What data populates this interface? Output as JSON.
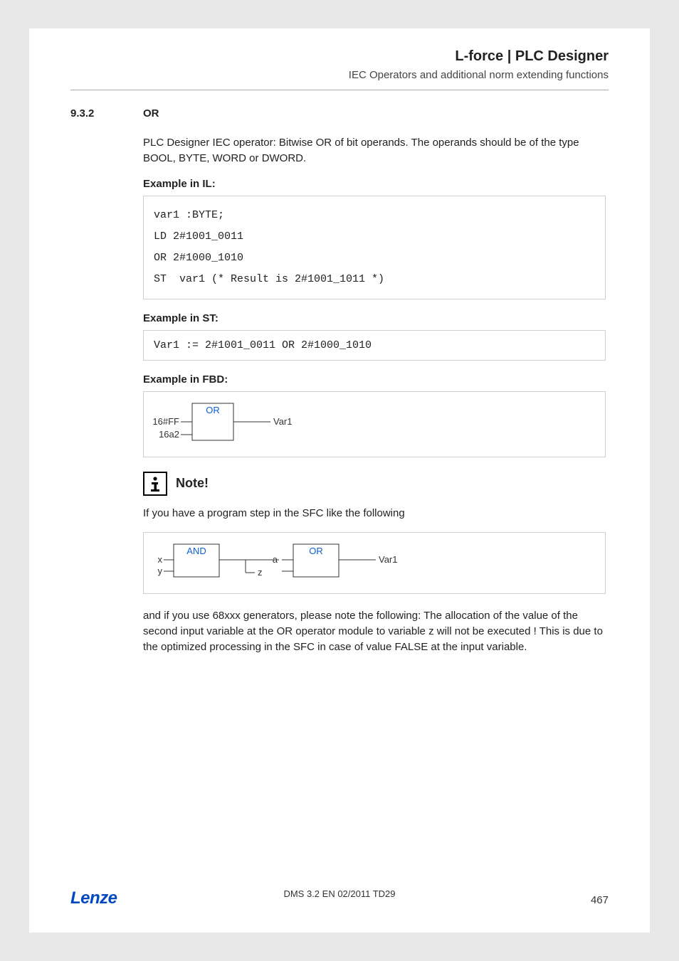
{
  "header": {
    "title": "L-force | PLC Designer",
    "subtitle": "IEC Operators and additional norm extending functions"
  },
  "section": {
    "number": "9.3.2",
    "title": "OR"
  },
  "intro": "PLC Designer IEC operator: Bitwise OR of bit operands. The operands should be of the type BOOL, BYTE, WORD or DWORD.",
  "labels": {
    "example_il": "Example in IL:",
    "example_st": "Example in ST:",
    "example_fbd": "Example in FBD:",
    "note": "Note!"
  },
  "code": {
    "il": "var1 :BYTE;\nLD 2#1001_0011\nOR 2#1000_1010\nST  var1 (* Result is 2#1001_1011 *)",
    "st": "Var1 := 2#1001_0011 OR 2#1000_1010"
  },
  "fbd1": {
    "block": "OR",
    "in1": "16#FF",
    "in2": "16a2",
    "out": "Var1"
  },
  "note_intro": "If you have a program step in the SFC like the following",
  "fbd2": {
    "block1": "AND",
    "b1_in1": "x",
    "b1_in2": "y",
    "mid_out": "z",
    "mid_in": "a",
    "block2": "OR",
    "out": "Var1"
  },
  "note_body": "and if you use 68xxx generators, please note the following: The allocation of the value of the second input variable at the OR operator module to variable z will not be executed ! This is due to the optimized processing in the SFC in case of value FALSE at the input variable.",
  "footer": {
    "brand": "Lenze",
    "doc": "DMS 3.2 EN 02/2011 TD29",
    "page": "467"
  }
}
